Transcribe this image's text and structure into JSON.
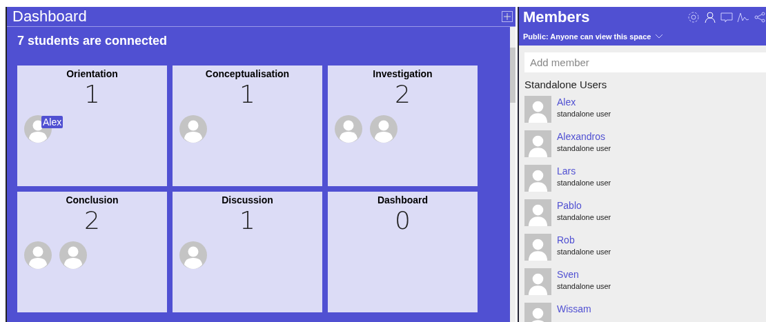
{
  "dashboard": {
    "title": "Dashboard",
    "summary": "7 students are connected",
    "phases": [
      {
        "name": "Orientation",
        "count": "1",
        "students": [
          {
            "kind": "avatar",
            "tag": "Alex"
          }
        ]
      },
      {
        "name": "Conceptualisation",
        "count": "1",
        "students": [
          {
            "kind": "avatar"
          }
        ]
      },
      {
        "name": "Investigation",
        "count": "2",
        "students": [
          {
            "kind": "avatar"
          },
          {
            "kind": "avatar"
          }
        ]
      },
      {
        "name": "Conclusion",
        "count": "2",
        "students": [
          {
            "kind": "avatar"
          },
          {
            "kind": "avatar"
          }
        ]
      },
      {
        "name": "Discussion",
        "count": "1",
        "students": [
          {
            "kind": "avatar"
          }
        ]
      },
      {
        "name": "Dashboard",
        "count": "0"
      }
    ]
  },
  "members": {
    "title": "Members",
    "visibility": "Public: Anyone can view this space",
    "add_placeholder": "Add member",
    "section": "Standalone Users",
    "users": [
      {
        "name": "Alex",
        "role": "standalone user"
      },
      {
        "name": "Alexandros",
        "role": "standalone user"
      },
      {
        "name": "Lars",
        "role": "standalone user"
      },
      {
        "name": "Pablo",
        "role": "standalone user"
      },
      {
        "name": "Rob",
        "role": "standalone user"
      },
      {
        "name": "Sven",
        "role": "standalone user"
      },
      {
        "name": "Wissam"
      }
    ]
  }
}
